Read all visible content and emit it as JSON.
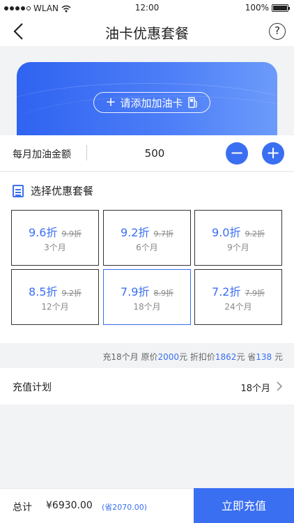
{
  "status_bar": {
    "network": "WLAN",
    "time": "12:00",
    "battery": "100%"
  },
  "nav": {
    "title": "油卡优惠套餐",
    "help_icon": "?"
  },
  "add_card": {
    "plus": "+",
    "label": "请添加加油卡"
  },
  "amount": {
    "label": "每月加油金额",
    "value": "500",
    "minus": "−",
    "plus": "+"
  },
  "plans": {
    "title": "选择优惠套餐",
    "items": [
      {
        "discount": "9.6折",
        "original": "9.9折",
        "months": "3个月"
      },
      {
        "discount": "9.2折",
        "original": "9.7折",
        "months": "6个月"
      },
      {
        "discount": "9.0折",
        "original": "9.2折",
        "months": "9个月"
      },
      {
        "discount": "8.5折",
        "original": "9.2折",
        "months": "12个月"
      },
      {
        "discount": "7.9折",
        "original": "8.9折",
        "months": "18个月"
      },
      {
        "discount": "7.2折",
        "original": "7.9折",
        "months": "24个月"
      }
    ]
  },
  "summary": {
    "prefix": "充18个月 原价",
    "original_price": "2000",
    "unit1": "元 折扣价",
    "discount_price": "1862",
    "unit2": "元 省",
    "saved": "138",
    "unit3": " 元"
  },
  "recharge": {
    "label": "充值计划",
    "value": "18个月"
  },
  "footer": {
    "total_label": "总计",
    "total_amount": "¥6930.00",
    "saving": "(省2070.00)",
    "submit": "立即充值"
  },
  "colors": {
    "accent": "#3a6ff2"
  }
}
